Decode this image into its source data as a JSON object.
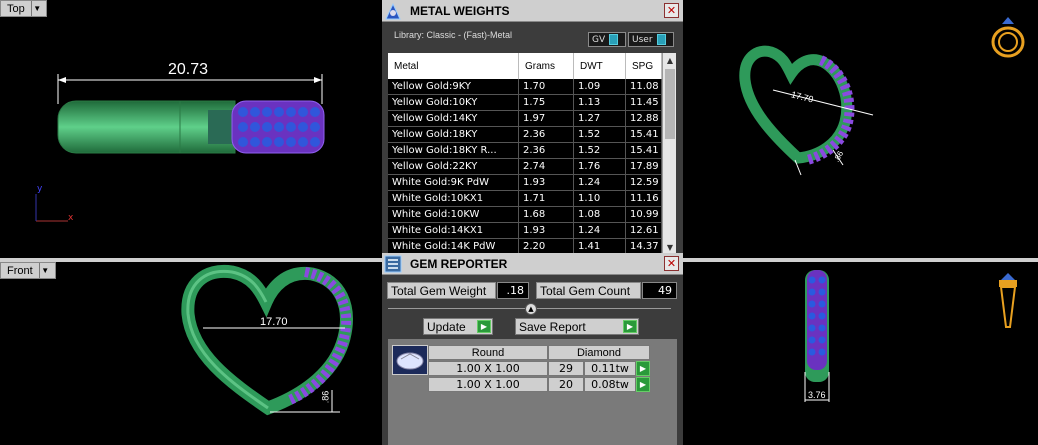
{
  "viewports": {
    "top": {
      "label": "Top",
      "dimension": "20.73",
      "axis_y": "y",
      "axis_x": "x"
    },
    "front": {
      "label": "Front",
      "dimension": "17.70",
      "small_dimension": ".86"
    },
    "perspective": {
      "dimension": "17.70",
      "small_dimension": ".86"
    },
    "right": {
      "dimension": "3.76"
    }
  },
  "metal_weights": {
    "title": "METAL WEIGHTS",
    "library": "Library: Classic - (Fast)-Metal",
    "toggle_gv": "GV",
    "toggle_user": "User",
    "columns": [
      "Metal",
      "Grams",
      "DWT",
      "SPG"
    ],
    "rows": [
      [
        "Yellow Gold:9KY",
        "1.70",
        "1.09",
        "11.08"
      ],
      [
        "Yellow Gold:10KY",
        "1.75",
        "1.13",
        "11.45"
      ],
      [
        "Yellow Gold:14KY",
        "1.97",
        "1.27",
        "12.88"
      ],
      [
        "Yellow Gold:18KY",
        "2.36",
        "1.52",
        "15.41"
      ],
      [
        "Yellow Gold:18KY R...",
        "2.36",
        "1.52",
        "15.41"
      ],
      [
        "Yellow Gold:22KY",
        "2.74",
        "1.76",
        "17.89"
      ],
      [
        "White Gold:9K PdW",
        "1.93",
        "1.24",
        "12.59"
      ],
      [
        "White Gold:10KX1",
        "1.71",
        "1.10",
        "11.16"
      ],
      [
        "White Gold:10KW",
        "1.68",
        "1.08",
        "10.99"
      ],
      [
        "White Gold:14KX1",
        "1.93",
        "1.24",
        "12.61"
      ],
      [
        "White Gold:14K PdW",
        "2.20",
        "1.41",
        "14.37"
      ]
    ]
  },
  "gem_reporter": {
    "title": "GEM REPORTER",
    "total_weight_label": "Total Gem Weight",
    "total_weight_value": ".18",
    "total_count_label": "Total Gem Count",
    "total_count_value": "49",
    "update_label": "Update",
    "save_label": "Save Report",
    "shape_header": "Round",
    "type_header": "Diamond",
    "gems": [
      {
        "size": "1.00 X 1.00",
        "count": "29",
        "tw": "0.11tw"
      },
      {
        "size": "1.00 X 1.00",
        "count": "20",
        "tw": "0.08tw"
      }
    ]
  },
  "colors": {
    "metal": "#2e9a5a",
    "gems": "#7a3fd0",
    "panel": "#3c3c3c",
    "accent": "#2aa0b8"
  }
}
